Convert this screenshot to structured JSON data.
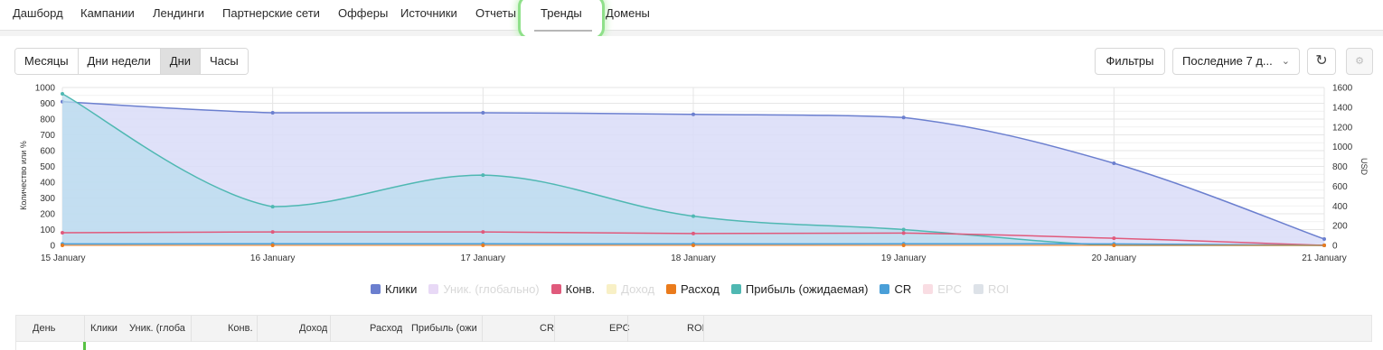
{
  "nav": {
    "items": [
      "Дашборд",
      "Кампании",
      "Лендинги",
      "Партнерские сети",
      "Офферы",
      "Источники",
      "Отчеты",
      "Тренды",
      "Домены"
    ],
    "active": "Тренды"
  },
  "toolbar": {
    "segments": [
      "Месяцы",
      "Дни недели",
      "Дни",
      "Часы"
    ],
    "active_segment": "Дни",
    "filters_label": "Фильтры",
    "period_label": "Последние 7 д...",
    "chevron_icon": "chevron-down-icon",
    "refresh_icon": "refresh-icon",
    "gear_icon": "gear-icon"
  },
  "chart_data": {
    "type": "area",
    "x": [
      "15 January",
      "16 January",
      "17 January",
      "18 January",
      "19 January",
      "20 January",
      "21 January"
    ],
    "y_left": {
      "label": "Количество или %",
      "ticks": [
        0,
        100,
        200,
        300,
        400,
        500,
        600,
        700,
        800,
        900,
        1000
      ],
      "range": [
        0,
        1000
      ]
    },
    "y_right": {
      "label": "USD",
      "ticks": [
        0,
        200,
        400,
        600,
        800,
        1000,
        1200,
        1400,
        1600
      ],
      "range": [
        0,
        1600
      ]
    },
    "grid": true,
    "legend_position": "bottom",
    "series": [
      {
        "name": "Клики",
        "axis": "left",
        "color": "#6b7fcf",
        "fill": "#d9dcf8",
        "values": [
          910,
          840,
          840,
          830,
          810,
          520,
          40
        ],
        "visible": true
      },
      {
        "name": "Уник. (глобально)",
        "axis": "left",
        "color": "#e8d9f6",
        "values": [],
        "visible": false
      },
      {
        "name": "Конв.",
        "axis": "left",
        "color": "#e05a7c",
        "values": [
          80,
          85,
          85,
          75,
          78,
          45,
          0
        ],
        "visible": true
      },
      {
        "name": "Доход",
        "axis": "left",
        "color": "#f8f0c6",
        "values": [],
        "visible": false
      },
      {
        "name": "Расход",
        "axis": "left",
        "color": "#ea7b1c",
        "values": [
          0,
          0,
          0,
          0,
          0,
          0,
          0
        ],
        "visible": true
      },
      {
        "name": "Прибыль (ожидаемая)",
        "axis": "left",
        "color": "#4fb8b2",
        "fill": "#b9dced",
        "values": [
          960,
          245,
          445,
          185,
          100,
          0,
          0
        ],
        "visible": true
      },
      {
        "name": "CR",
        "axis": "left",
        "color": "#4a9fd8",
        "values": [
          9,
          10,
          10,
          9,
          10,
          9,
          0
        ],
        "visible": true
      },
      {
        "name": "EPC",
        "axis": "left",
        "color": "#f9dde3",
        "values": [],
        "visible": false
      },
      {
        "name": "ROI",
        "axis": "left",
        "color": "#dde2e8",
        "values": [],
        "visible": false
      }
    ]
  },
  "table": {
    "columns": [
      "День",
      "Клики",
      "Уник. (глоба",
      "Конв.",
      "Доход",
      "Расход",
      "Прибыль (ожи",
      "CR",
      "EPC",
      "ROI"
    ]
  }
}
